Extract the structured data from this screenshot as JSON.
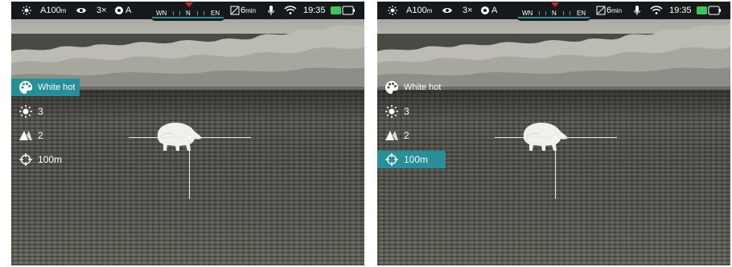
{
  "screens": [
    {
      "id": "left",
      "status": {
        "zoom": "A100",
        "zoom_unit": "m",
        "magnification": "3×",
        "mode": "A",
        "sleep": "6",
        "sleep_unit": "min",
        "time": "19:35"
      },
      "compass": {
        "left": "WN",
        "center": "N",
        "right": "EN"
      },
      "menu": {
        "active_item": "palette",
        "palette_label": "White hot",
        "brightness_value": "3",
        "contrast_value": "2",
        "range_value": "100m"
      }
    },
    {
      "id": "right",
      "status": {
        "zoom": "A100",
        "zoom_unit": "m",
        "magnification": "3×",
        "mode": "A",
        "sleep": "6",
        "sleep_unit": "min",
        "time": "19:35"
      },
      "compass": {
        "left": "WN",
        "center": "N",
        "right": "EN"
      },
      "menu": {
        "active_item": "range",
        "palette_label": "White hot",
        "brightness_value": "3",
        "contrast_value": "2",
        "range_value": "100m"
      }
    }
  ],
  "colors": {
    "accent": "#268f97",
    "status_bar": "#15191b",
    "battery": "#3ec45b",
    "compass_marker": "#c9252c"
  },
  "icons": {
    "brightness": "sun-icon",
    "visibility": "eye-icon",
    "mode": "gear-icon",
    "sleep": "sleep-timer-icon",
    "microphone": "microphone-icon",
    "wifi": "wifi-icon",
    "battery": "battery-icon",
    "palette": "palette-icon",
    "contrast": "contrast-icon",
    "range": "crosshair-icon"
  }
}
